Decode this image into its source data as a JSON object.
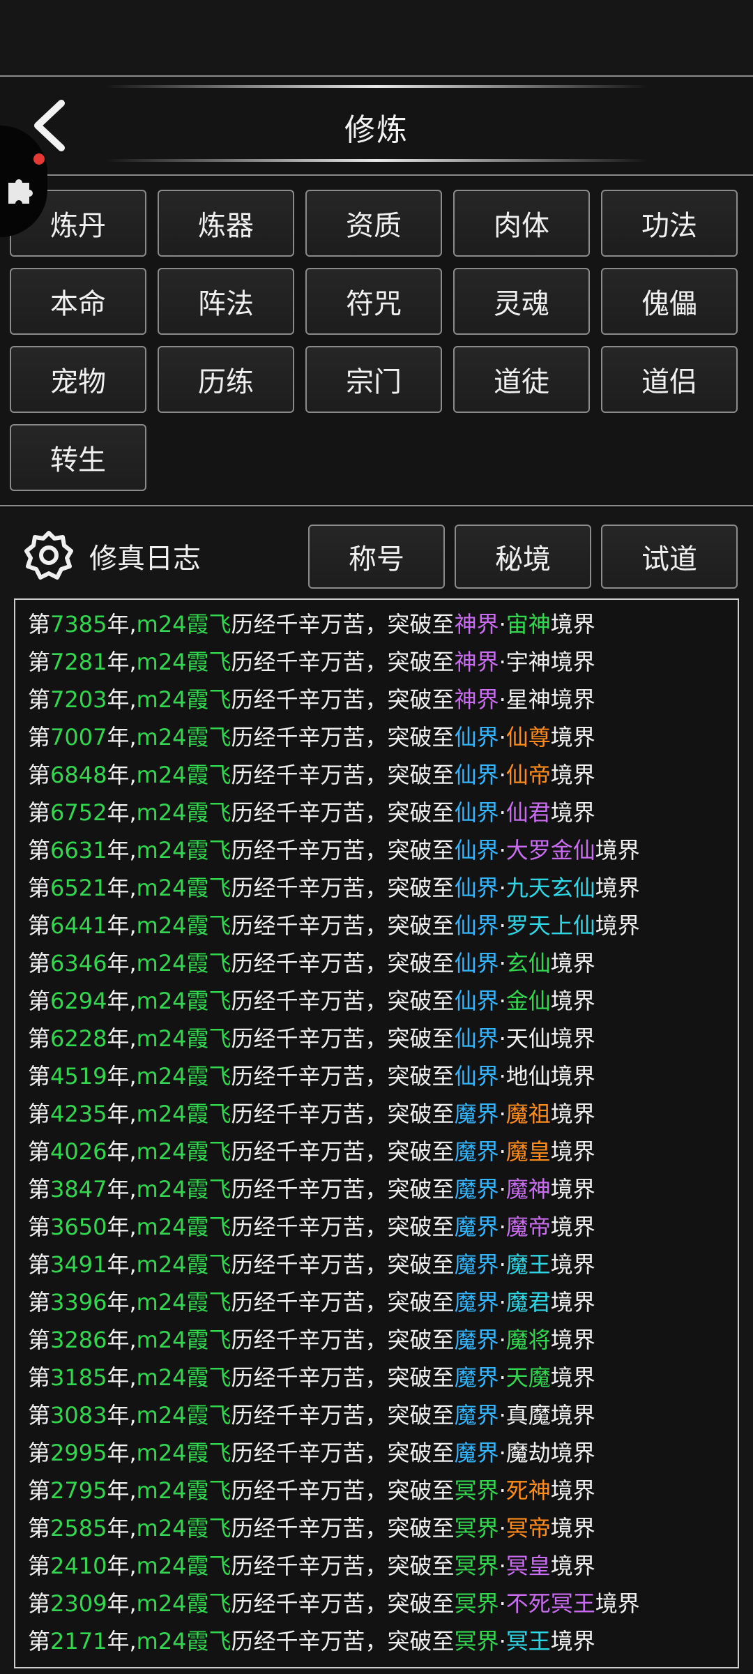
{
  "header": {
    "title": "修炼"
  },
  "buttons": [
    "炼丹",
    "炼器",
    "资质",
    "肉体",
    "功法",
    "本命",
    "阵法",
    "符咒",
    "灵魂",
    "傀儡",
    "宠物",
    "历练",
    "宗门",
    "道徒",
    "道侣",
    "转生"
  ],
  "log": {
    "title": "修真日志",
    "tabs": [
      "称号",
      "秘境",
      "试道"
    ],
    "prefix": "第",
    "year_suffix": "年,",
    "player": "m24霞飞",
    "action": "历经千辛万苦，突破至",
    "dot": "·",
    "suffix": "境界",
    "colors": {
      "purple": "#c86cf0",
      "blue": "#33b6ff",
      "orange": "#ff8c1a",
      "cyan": "#2ed6e6",
      "green": "#33d74f",
      "white": "#f0f0f0"
    },
    "entries": [
      {
        "year": "7385",
        "world": "神界",
        "wcolor": "#c86cf0",
        "realm": "宙神",
        "rcolor": "#33d74f"
      },
      {
        "year": "7281",
        "world": "神界",
        "wcolor": "#c86cf0",
        "realm": "宇神",
        "rcolor": "#f0f0f0"
      },
      {
        "year": "7203",
        "world": "神界",
        "wcolor": "#c86cf0",
        "realm": "星神",
        "rcolor": "#f0f0f0"
      },
      {
        "year": "7007",
        "world": "仙界",
        "wcolor": "#33b6ff",
        "realm": "仙尊",
        "rcolor": "#ff8c1a"
      },
      {
        "year": "6848",
        "world": "仙界",
        "wcolor": "#33b6ff",
        "realm": "仙帝",
        "rcolor": "#ff8c1a"
      },
      {
        "year": "6752",
        "world": "仙界",
        "wcolor": "#33b6ff",
        "realm": "仙君",
        "rcolor": "#c86cf0"
      },
      {
        "year": "6631",
        "world": "仙界",
        "wcolor": "#33b6ff",
        "realm": "大罗金仙",
        "rcolor": "#c86cf0"
      },
      {
        "year": "6521",
        "world": "仙界",
        "wcolor": "#33b6ff",
        "realm": "九天玄仙",
        "rcolor": "#2ed6e6"
      },
      {
        "year": "6441",
        "world": "仙界",
        "wcolor": "#33b6ff",
        "realm": "罗天上仙",
        "rcolor": "#2ed6e6"
      },
      {
        "year": "6346",
        "world": "仙界",
        "wcolor": "#33b6ff",
        "realm": "玄仙",
        "rcolor": "#33d74f"
      },
      {
        "year": "6294",
        "world": "仙界",
        "wcolor": "#33b6ff",
        "realm": "金仙",
        "rcolor": "#33d74f"
      },
      {
        "year": "6228",
        "world": "仙界",
        "wcolor": "#33b6ff",
        "realm": "天仙",
        "rcolor": "#f0f0f0"
      },
      {
        "year": "4519",
        "world": "仙界",
        "wcolor": "#33b6ff",
        "realm": "地仙",
        "rcolor": "#f0f0f0"
      },
      {
        "year": "4235",
        "world": "魔界",
        "wcolor": "#33b6ff",
        "realm": "魔祖",
        "rcolor": "#ff8c1a"
      },
      {
        "year": "4026",
        "world": "魔界",
        "wcolor": "#33b6ff",
        "realm": "魔皇",
        "rcolor": "#ff8c1a"
      },
      {
        "year": "3847",
        "world": "魔界",
        "wcolor": "#33b6ff",
        "realm": "魔神",
        "rcolor": "#c86cf0"
      },
      {
        "year": "3650",
        "world": "魔界",
        "wcolor": "#33b6ff",
        "realm": "魔帝",
        "rcolor": "#c86cf0"
      },
      {
        "year": "3491",
        "world": "魔界",
        "wcolor": "#33b6ff",
        "realm": "魔王",
        "rcolor": "#2ed6e6"
      },
      {
        "year": "3396",
        "world": "魔界",
        "wcolor": "#33b6ff",
        "realm": "魔君",
        "rcolor": "#2ed6e6"
      },
      {
        "year": "3286",
        "world": "魔界",
        "wcolor": "#33b6ff",
        "realm": "魔将",
        "rcolor": "#33d74f"
      },
      {
        "year": "3185",
        "world": "魔界",
        "wcolor": "#33b6ff",
        "realm": "天魔",
        "rcolor": "#33d74f"
      },
      {
        "year": "3083",
        "world": "魔界",
        "wcolor": "#33b6ff",
        "realm": "真魔",
        "rcolor": "#f0f0f0"
      },
      {
        "year": "2995",
        "world": "魔界",
        "wcolor": "#33b6ff",
        "realm": "魔劫",
        "rcolor": "#f0f0f0"
      },
      {
        "year": "2795",
        "world": "冥界",
        "wcolor": "#33d74f",
        "realm": "死神",
        "rcolor": "#ff8c1a"
      },
      {
        "year": "2585",
        "world": "冥界",
        "wcolor": "#33d74f",
        "realm": "冥帝",
        "rcolor": "#ff8c1a"
      },
      {
        "year": "2410",
        "world": "冥界",
        "wcolor": "#33d74f",
        "realm": "冥皇",
        "rcolor": "#c86cf0"
      },
      {
        "year": "2309",
        "world": "冥界",
        "wcolor": "#33d74f",
        "realm": "不死冥王",
        "rcolor": "#c86cf0"
      },
      {
        "year": "2171",
        "world": "冥界",
        "wcolor": "#33d74f",
        "realm": "冥王",
        "rcolor": "#2ed6e6"
      }
    ]
  }
}
